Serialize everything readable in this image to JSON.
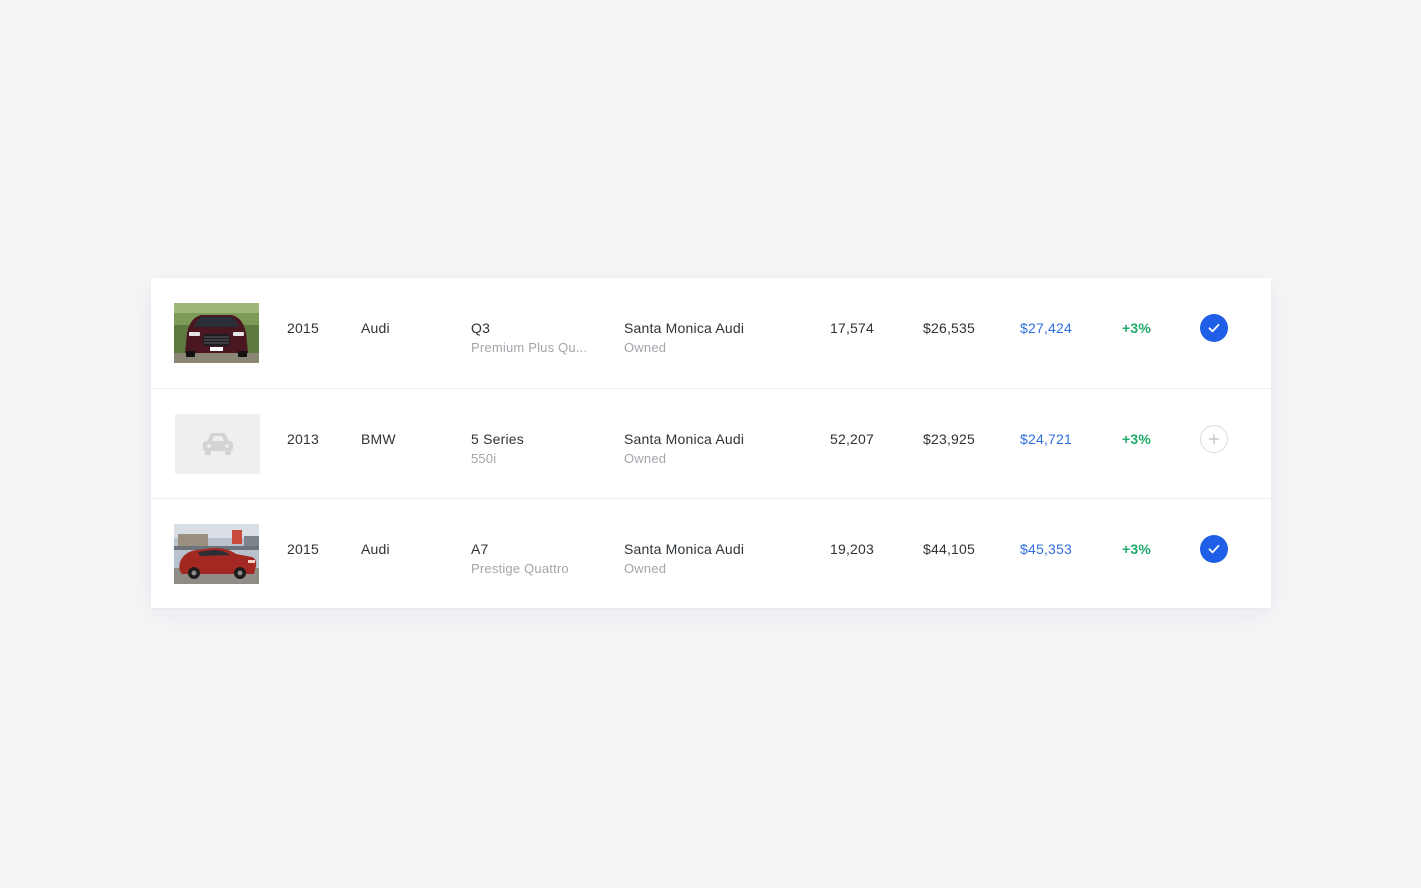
{
  "vehicles": [
    {
      "year": "2015",
      "make": "Audi",
      "model": "Q3",
      "trim": "Premium Plus Qu...",
      "location": "Santa Monica Audi",
      "ownership": "Owned",
      "mileage": "17,574",
      "price": "$26,535",
      "market_value": "$27,424",
      "change": "+3%",
      "selected": true,
      "image": "dark red audi q3 front view"
    },
    {
      "year": "2013",
      "make": "BMW",
      "model": "5 Series",
      "trim": "550i",
      "location": "Santa Monica Audi",
      "ownership": "Owned",
      "mileage": "52,207",
      "price": "$23,925",
      "market_value": "$24,721",
      "change": "+3%",
      "selected": false,
      "image": "car-placeholder-icon"
    },
    {
      "year": "2015",
      "make": "Audi",
      "model": "A7",
      "trim": "Prestige Quattro",
      "location": "Santa Monica Audi",
      "ownership": "Owned",
      "mileage": "19,203",
      "price": "$44,105",
      "market_value": "$45,353",
      "change": "+3%",
      "selected": true,
      "image": "red sedan on dealership lot"
    }
  ],
  "colors": {
    "background": "#f4f5f7",
    "card": "#ffffff",
    "primary_blue": "#1f5fe8",
    "market_value_blue": "#2f6fe0",
    "positive_green": "#1faa6a",
    "muted_text": "#a2a6ab"
  },
  "icons": {
    "selected": "check-icon",
    "unselected": "plus-icon",
    "no_photo": "car-placeholder-icon"
  }
}
